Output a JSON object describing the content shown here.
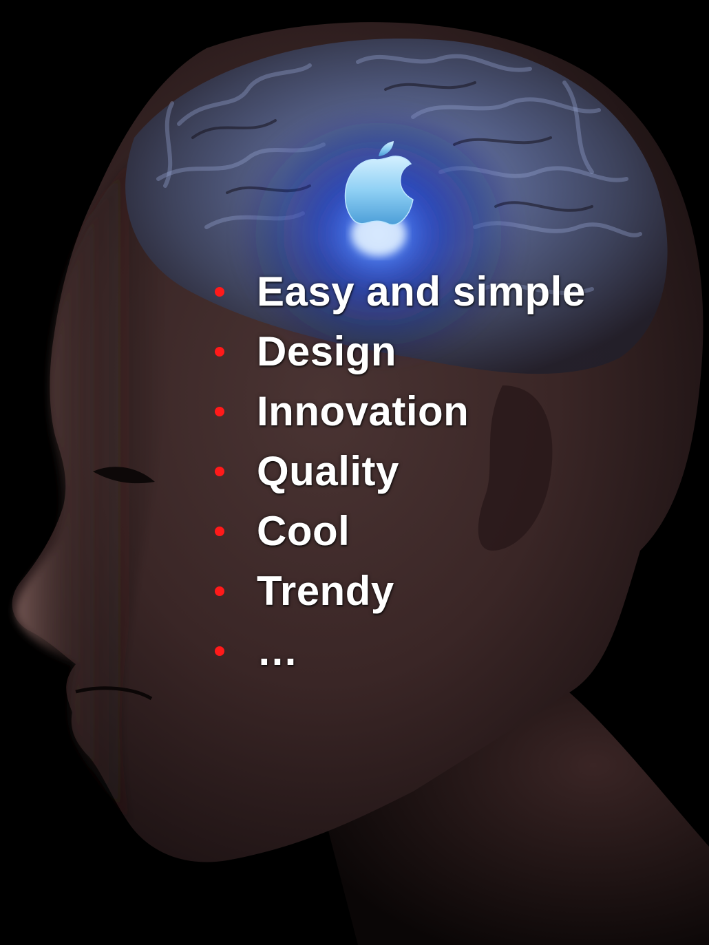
{
  "scene": {
    "subject": "man-head-profile-with-brain",
    "logo_icon": "apple-logo-icon"
  },
  "bullets": {
    "items": [
      {
        "label": "Easy and simple"
      },
      {
        "label": "Design"
      },
      {
        "label": "Innovation"
      },
      {
        "label": "Quality"
      },
      {
        "label": "Cool"
      },
      {
        "label": "Trendy"
      },
      {
        "label": "…"
      }
    ]
  },
  "colors": {
    "background": "#000000",
    "bullet": "#ff1a1a",
    "text": "#ffffff",
    "glow": "#1a4dff",
    "logo": "#7fc4f0"
  }
}
